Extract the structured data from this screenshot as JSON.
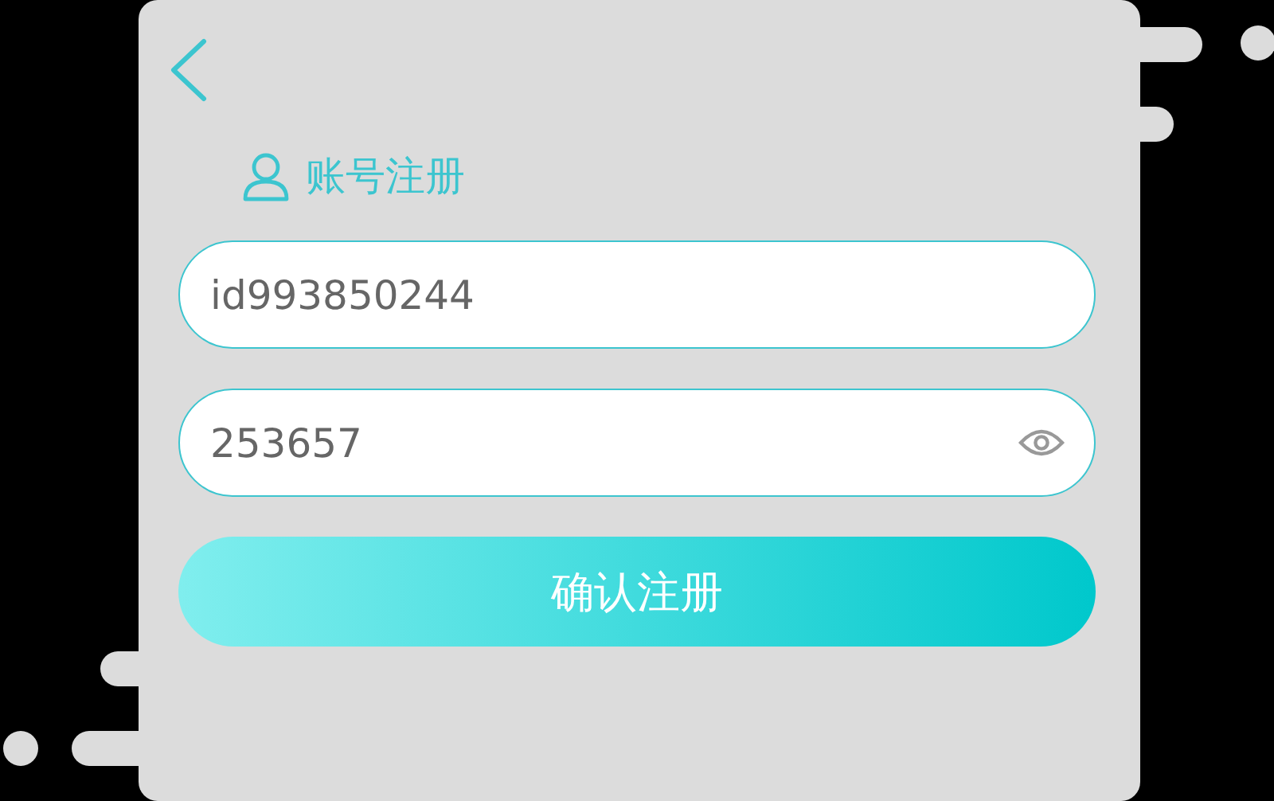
{
  "header": {
    "title": "账号注册"
  },
  "fields": [
    {
      "kind": "text",
      "value": "id993850244"
    },
    {
      "kind": "password",
      "value": "253657"
    }
  ],
  "submit_button": {
    "label": "确认注册"
  }
}
